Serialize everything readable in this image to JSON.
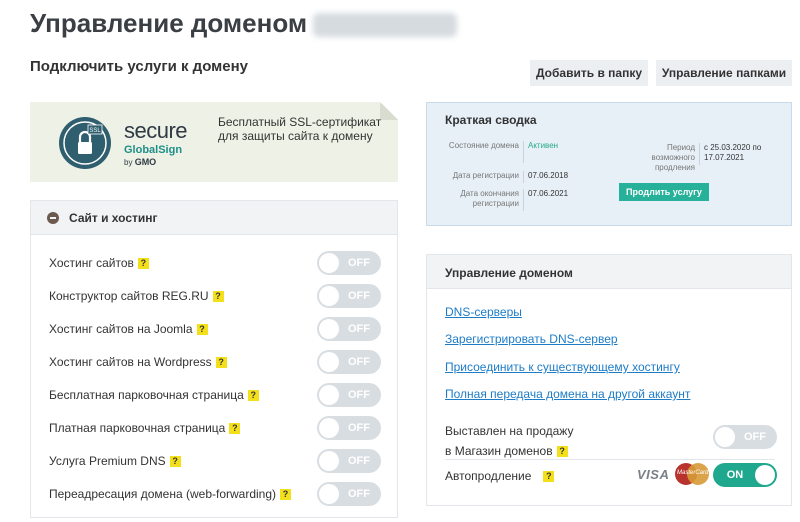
{
  "header": {
    "title": "Управление доменом",
    "subtitle": "Подключить услуги к домену",
    "add_to_folder": "Добавить в папку",
    "manage_folders": "Управление папками"
  },
  "ssl_banner": {
    "brand_secure": "secure",
    "brand_globalsign": "GlobalSign",
    "brand_by": "by",
    "brand_gmo": "GMO",
    "badge": "SSL",
    "text": "Бесплатный SSL-сертификат для защиты сайта к домену"
  },
  "site_hosting": {
    "title": "Сайт и хостинг",
    "help_mark": "?",
    "toggle_off": "OFF",
    "items": [
      {
        "label": "Хостинг сайтов",
        "state": "OFF"
      },
      {
        "label": "Конструктор сайтов REG.RU",
        "state": "OFF"
      },
      {
        "label": "Хостинг сайтов на Joomla",
        "state": "OFF"
      },
      {
        "label": "Хостинг сайтов на Wordpress",
        "state": "OFF"
      },
      {
        "label": "Бесплатная парковочная страница",
        "state": "OFF"
      },
      {
        "label": "Платная парковочная страница",
        "state": "OFF"
      },
      {
        "label": "Услуга Premium DNS",
        "state": "OFF"
      },
      {
        "label": "Переадресация домена (web-forwarding)",
        "state": "OFF"
      }
    ]
  },
  "summary": {
    "title": "Краткая сводка",
    "status_label": "Состояние домена",
    "status_value": "Активен",
    "reg_date_label": "Дата регистрации",
    "reg_date_value": "07.06.2018",
    "end_date_label": "Дата окончания регистрации",
    "end_date_value": "07.06.2021",
    "period_label": "Период возможного продления",
    "period_value": "с 25.03.2020 по 17.07.2021",
    "renew_button": "Продлить услугу"
  },
  "domain_management": {
    "title": "Управление доменом",
    "links": [
      "DNS-серверы",
      "Зарегистрировать DNS-сервер",
      "Присоединить к существующему хостингу",
      "Полная передача домена на другой аккаунт"
    ],
    "for_sale_line1": "Выставлен на продажу",
    "for_sale_line2": "в Магазин доменов",
    "for_sale_state": "OFF",
    "autorenew_label": "Автопродление",
    "autorenew_state": "ON",
    "visa": "VISA",
    "mastercard": "MasterCard"
  },
  "colors": {
    "accent_green": "#20a88e",
    "link_blue": "#1e7cc7",
    "help_yellow": "#f3e01a",
    "toggle_off": "#d8dde2"
  },
  "icons": [
    "ssl-lock-icon",
    "minus-circle-icon",
    "help-icon",
    "visa-icon",
    "mastercard-icon"
  ]
}
